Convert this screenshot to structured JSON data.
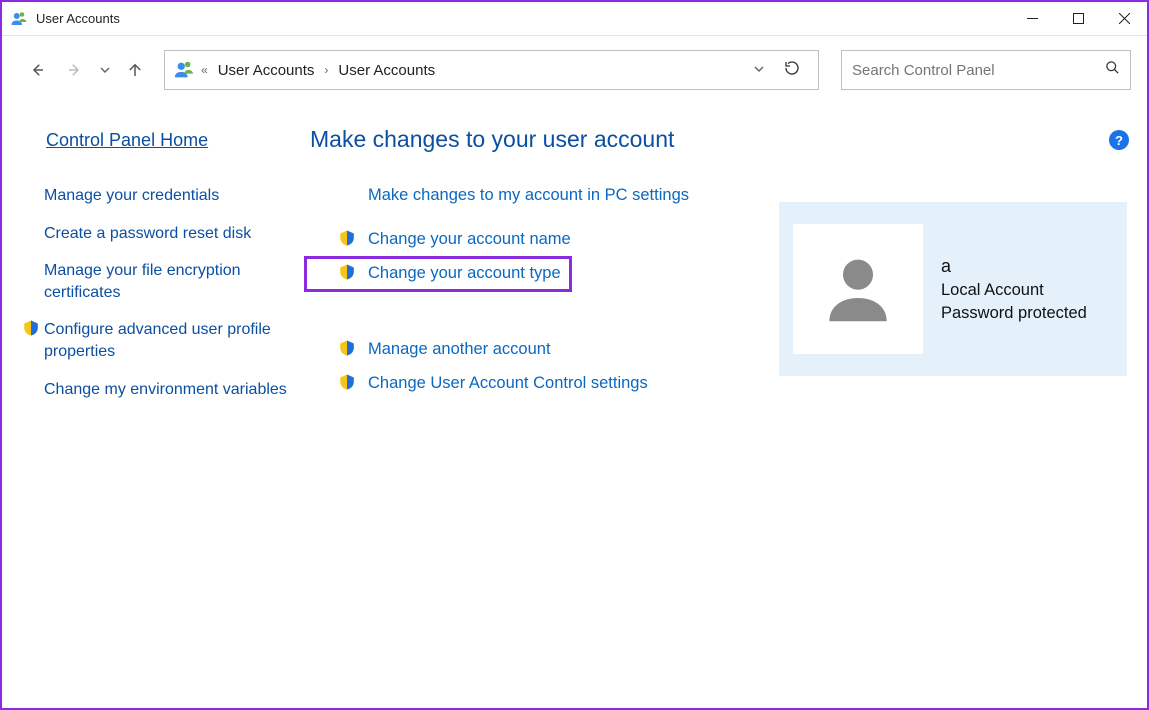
{
  "window": {
    "title": "User Accounts"
  },
  "breadcrumbs": {
    "a": "User Accounts",
    "b": "User Accounts"
  },
  "search": {
    "placeholder": "Search Control Panel"
  },
  "sidebar": {
    "home": "Control Panel Home",
    "items": [
      {
        "label": "Manage your credentials",
        "shield": false
      },
      {
        "label": "Create a password reset disk",
        "shield": false
      },
      {
        "label": "Manage your file encryption certificates",
        "shield": false
      },
      {
        "label": "Configure advanced user profile properties",
        "shield": true
      },
      {
        "label": "Change my environment variables",
        "shield": false
      }
    ]
  },
  "main": {
    "heading": "Make changes to your user account",
    "links": [
      {
        "label": "Make changes to my account in PC settings",
        "shield": false
      },
      {
        "label": "Change your account name",
        "shield": true
      },
      {
        "label": "Change your account type",
        "shield": true,
        "highlighted": true
      },
      {
        "label": "Manage another account",
        "shield": true
      },
      {
        "label": "Change User Account Control settings",
        "shield": true
      }
    ]
  },
  "account": {
    "name": "a",
    "type": "Local Account",
    "status": "Password protected"
  }
}
